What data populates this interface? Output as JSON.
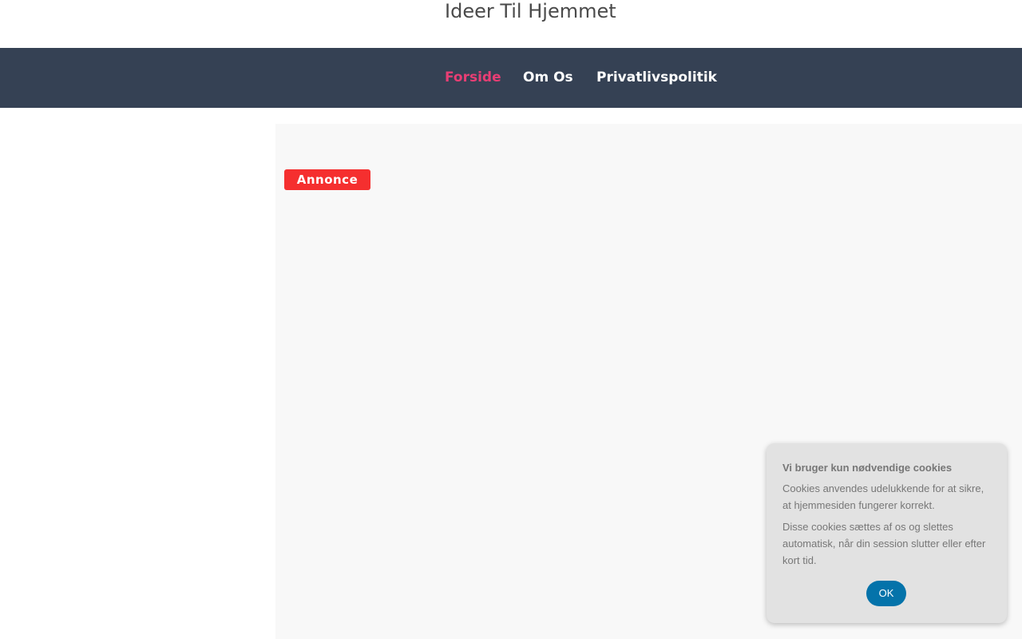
{
  "header": {
    "title": "Ideer Til Hjemmet"
  },
  "navigation": {
    "items": [
      {
        "label": "Forside",
        "state": "active"
      },
      {
        "label": "Om Os",
        "state": "default"
      },
      {
        "label": "Privatlivspolitik",
        "state": "default"
      }
    ]
  },
  "content": {
    "ad_label": "Annonce"
  },
  "cookie_notice": {
    "heading": "Vi bruger kun nødvendige cookies",
    "paragraph_1": "Cookies anvendes udelukkende for at sikre, at hjemmesiden fungerer korrekt.",
    "paragraph_2": "Disse cookies sættes af os og slettes automatisk, når din session slutter eller efter kort tid.",
    "button_label": "OK"
  },
  "colors": {
    "page_background": "#ffffff",
    "navigation_background": "#354154",
    "active_navigation": "#e83e74",
    "content_background": "#f8f8f8",
    "ad_badge": "#f52f2f",
    "cookie_background": "#e2e2e2",
    "cookie_button": "#0473aa"
  }
}
